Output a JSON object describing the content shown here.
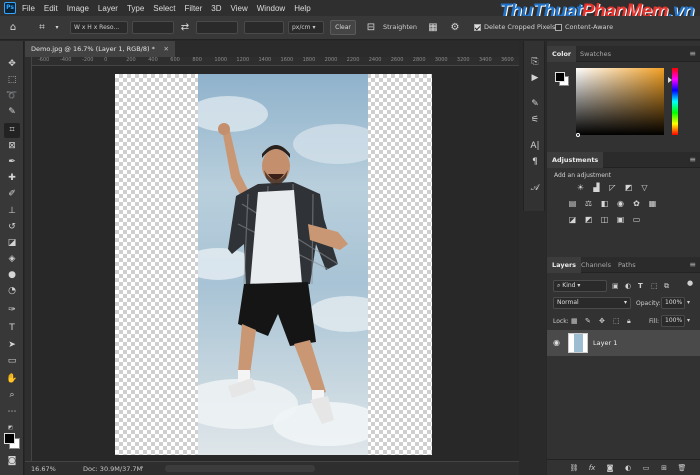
{
  "menu": [
    "File",
    "Edit",
    "Image",
    "Layer",
    "Type",
    "Select",
    "Filter",
    "3D",
    "View",
    "Window",
    "Help"
  ],
  "watermark": {
    "part1": "Thu",
    "part2": "Thuat",
    "part3": "PhanMem",
    "suffix": ".vn"
  },
  "options": {
    "ratio_label": "W x H x Reso...",
    "unit": "px/cm",
    "clear": "Clear",
    "straighten": "Straighten",
    "delete_cropped": "Delete Cropped Pixels",
    "content_aware": "Content-Aware"
  },
  "document": {
    "tab_title": "Demo.jpg @ 16.7% (Layer 1, RGB/8) *",
    "ruler_ticks": [
      "-600",
      "-400",
      "-200",
      "0",
      "200",
      "400",
      "600",
      "800",
      "1000",
      "1200",
      "1400",
      "1600",
      "1800",
      "2000",
      "2200",
      "2400",
      "2600",
      "2800",
      "3000",
      "3200",
      "3400",
      "3600"
    ]
  },
  "status": {
    "zoom": "16.67%",
    "doc": "Doc: 30.9M/37.7M"
  },
  "color_panel": {
    "tabs": [
      "Color",
      "Swatches"
    ]
  },
  "adjustments": {
    "title": "Adjustments",
    "add_label": "Add an adjustment"
  },
  "layers_panel": {
    "tabs": [
      "Layers",
      "Channels",
      "Paths"
    ],
    "kind": "Kind",
    "blend_mode": "Normal",
    "opacity_label": "Opacity:",
    "opacity": "100%",
    "lock_label": "Lock:",
    "fill_label": "Fill:",
    "fill": "100%",
    "layer_name": "Layer 1"
  },
  "colors": {
    "accent": "#31a8ff",
    "panel_bg": "#323232",
    "app_bg": "#282828"
  }
}
